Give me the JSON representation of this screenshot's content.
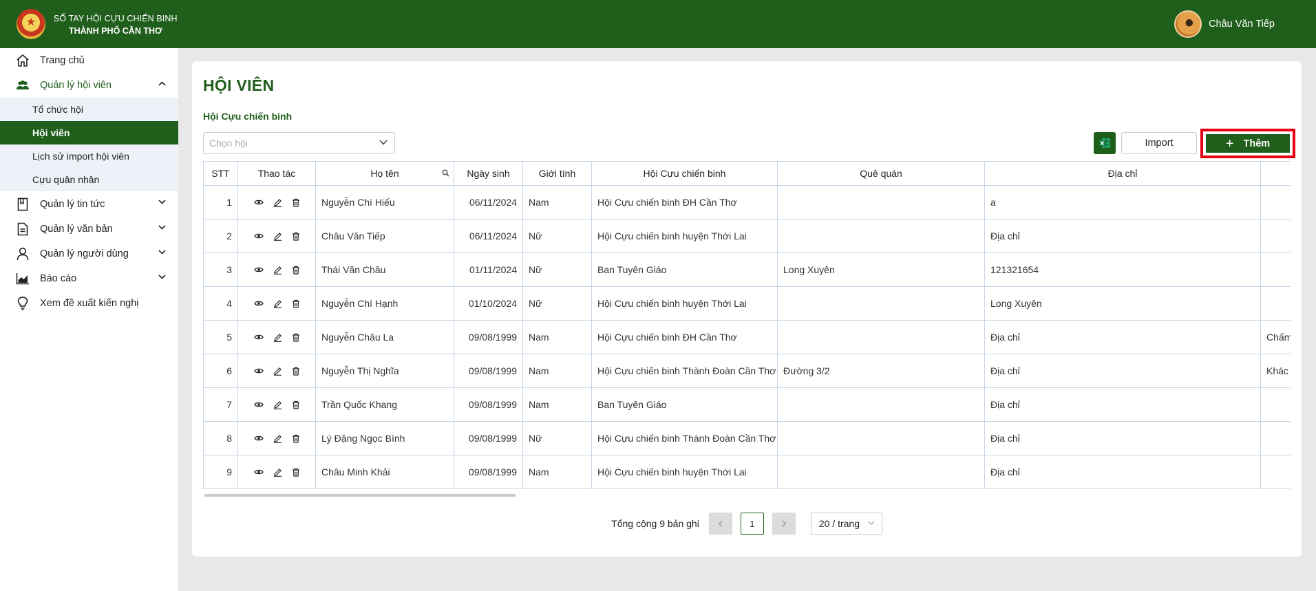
{
  "header": {
    "brand_line1": "SỔ TAY HỘI CỰU CHIẾN BINH",
    "brand_line2": "THÀNH PHỐ CẦN THƠ",
    "user_name": "Châu Văn Tiếp"
  },
  "sidebar": {
    "items": [
      {
        "label": "Trang chủ",
        "icon": "home-icon"
      },
      {
        "label": "Quản lý hội viên",
        "icon": "users-icon",
        "expanded": true,
        "children": [
          {
            "label": "Tổ chức hội"
          },
          {
            "label": "Hội viên",
            "active": true
          },
          {
            "label": "Lịch sử import hội viên"
          },
          {
            "label": "Cựu quân nhân"
          }
        ]
      },
      {
        "label": "Quản lý tin tức",
        "icon": "book-icon"
      },
      {
        "label": "Quản lý văn bản",
        "icon": "document-icon"
      },
      {
        "label": "Quản lý người dùng",
        "icon": "user-icon"
      },
      {
        "label": "Báo cáo",
        "icon": "chart-icon"
      },
      {
        "label": "Xem đề xuất kiến nghị",
        "icon": "lightbulb-icon"
      }
    ]
  },
  "main": {
    "title": "HỘI VIÊN",
    "filter_label": "Hội Cựu chiến binh",
    "filter_placeholder": "Chọn hội",
    "import_label": "Import",
    "add_label": "Thêm"
  },
  "table": {
    "columns": [
      "STT",
      "Thao tác",
      "Họ tên",
      "Ngày sinh",
      "Giới tính",
      "Hội Cựu chiến binh",
      "Quê quán",
      "Địa chỉ",
      ""
    ],
    "rows": [
      {
        "stt": "1",
        "name": "Nguyễn Chí Hiếu",
        "dob": "06/11/2024",
        "gender": "Nam",
        "org": "Hội Cựu chiến binh ĐH Cần Thơ",
        "hometown": "",
        "address": "a",
        "extra": ""
      },
      {
        "stt": "2",
        "name": "Châu Văn Tiếp",
        "dob": "06/11/2024",
        "gender": "Nữ",
        "org": "Hội Cựu chiến binh huyện Thới Lai",
        "hometown": "",
        "address": "Địa chỉ",
        "extra": ""
      },
      {
        "stt": "3",
        "name": "Thái Văn Châu",
        "dob": "01/11/2024",
        "gender": "Nữ",
        "org": "Ban Tuyên Giáo",
        "hometown": "Long Xuyên",
        "address": "121321654",
        "extra": ""
      },
      {
        "stt": "4",
        "name": "Nguyễn Chí Hạnh",
        "dob": "01/10/2024",
        "gender": "Nữ",
        "org": "Hội Cựu chiến binh huyện Thới Lai",
        "hometown": "",
        "address": "Long Xuyên",
        "extra": ""
      },
      {
        "stt": "5",
        "name": "Nguyễn Châu La",
        "dob": "09/08/1999",
        "gender": "Nam",
        "org": "Hội Cựu chiến binh ĐH Cần Thơ",
        "hometown": "",
        "address": "Địa chỉ",
        "extra": "Chấm"
      },
      {
        "stt": "6",
        "name": "Nguyễn Thị Nghĩa",
        "dob": "09/08/1999",
        "gender": "Nam",
        "org": "Hội Cựu chiến binh Thành Đoàn Cần Thơ",
        "hometown": "Đường 3/2",
        "address": "Địa chỉ",
        "extra": "Khác"
      },
      {
        "stt": "7",
        "name": "Trần Quốc Khang",
        "dob": "09/08/1999",
        "gender": "Nam",
        "org": "Ban Tuyên Giáo",
        "hometown": "",
        "address": "Địa chỉ",
        "extra": ""
      },
      {
        "stt": "8",
        "name": "Lý Đặng Ngọc Bình",
        "dob": "09/08/1999",
        "gender": "Nữ",
        "org": "Hội Cựu chiến binh Thành Đoàn Cần Thơ",
        "hometown": "",
        "address": "Địa chỉ",
        "extra": ""
      },
      {
        "stt": "9",
        "name": "Châu Minh Khải",
        "dob": "09/08/1999",
        "gender": "Nam",
        "org": "Hội Cựu chiến binh huyện Thới Lai",
        "hometown": "",
        "address": "Địa chỉ",
        "extra": ""
      }
    ]
  },
  "pagination": {
    "total_text": "Tổng cộng 9 bản ghi",
    "current_page": "1",
    "page_size": "20 / trang"
  },
  "colors": {
    "primary": "#1f5e1b",
    "highlight_border": "#e60012"
  }
}
